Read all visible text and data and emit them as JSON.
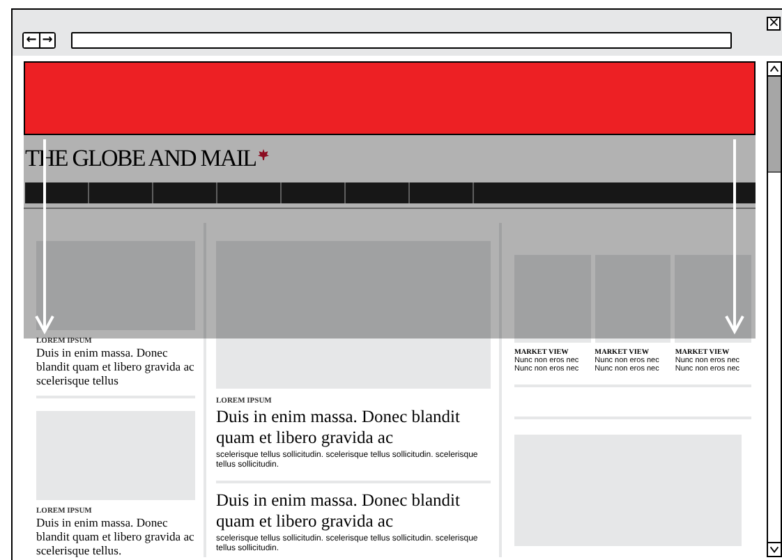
{
  "browser": {
    "back_icon": "←",
    "forward_icon": "→",
    "close_icon": "×"
  },
  "masthead": {
    "logo": "THE GLOBE AND MAIL"
  },
  "left_column": [
    {
      "kicker": "LOREM IPSUM",
      "headline": "Duis in enim massa. Donec blandit quam et libero gravida ac scelerisque tellus"
    },
    {
      "kicker": "LOREM IPSUM",
      "headline": "Duis in enim massa. Donec blandit quam et libero gravida ac scelerisque tellus."
    }
  ],
  "center_column": [
    {
      "kicker": "LOREM IPSUM",
      "headline": "Duis in enim massa. Donec blandit quam et libero gravida ac",
      "summary": "scelerisque tellus sollicitudin.  scelerisque tellus sollicitudin. scelerisque tellus sollicitudin."
    },
    {
      "headline": "Duis in enim massa. Donec blandit quam et libero gravida ac",
      "summary": "scelerisque tellus sollicitudin.  scelerisque tellus sollicitudin. scelerisque tellus sollicitudin."
    }
  ],
  "market": [
    {
      "label": "MARKET VIEW",
      "text": "Nunc non eros nec Nunc non eros nec"
    },
    {
      "label": "MARKET VIEW",
      "text": "Nunc non eros nec Nunc non eros nec"
    },
    {
      "label": "MARKET VIEW",
      "text": "Nunc non eros nec Nunc non eros nec"
    }
  ]
}
